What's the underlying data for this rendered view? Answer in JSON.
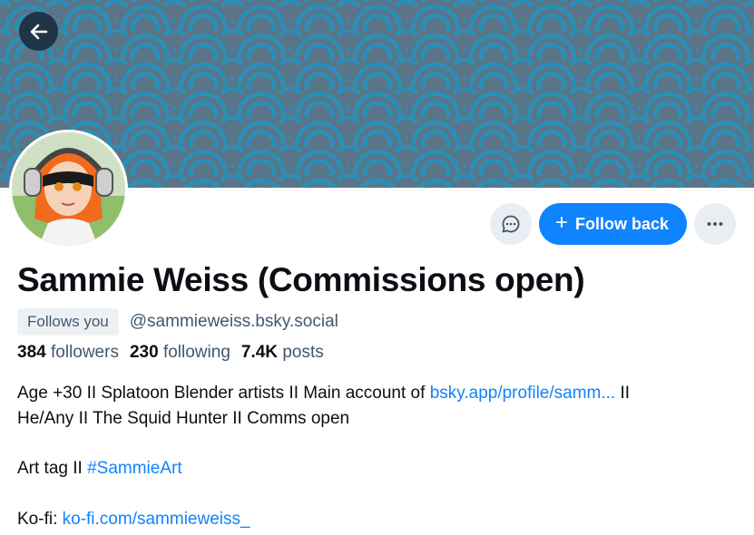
{
  "profile": {
    "display_name": "Sammie Weiss (Commissions open)",
    "follows_you": "Follows you",
    "handle": "@sammieweiss.bsky.social",
    "stats": {
      "followers_count": "384",
      "followers_label": "followers",
      "following_count": "230",
      "following_label": "following",
      "posts_count": "7.4K",
      "posts_label": "posts"
    },
    "bio": {
      "line1_text": "Age +30 II Splatoon Blender artists II Main account of ",
      "line1_link": "bsky.app/profile/samm...",
      "line1_tail": " II",
      "line2": "He/Any II The Squid Hunter II Comms open",
      "art_tag_text": "Art tag II ",
      "art_tag_link": "#SammieArt",
      "kofi_text": "Ko-fi: ",
      "kofi_link": "ko-fi.com/sammieweiss_"
    }
  },
  "actions": {
    "follow_back_label": "Follow back",
    "message_icon": "chat-bubble-icon",
    "more_icon": "ellipsis-icon",
    "back_icon": "arrow-left-icon"
  },
  "colors": {
    "accent": "#1083fe",
    "banner_primary": "#2b8fb5",
    "banner_secondary": "#5a7488",
    "muted_text": "#42576c"
  }
}
